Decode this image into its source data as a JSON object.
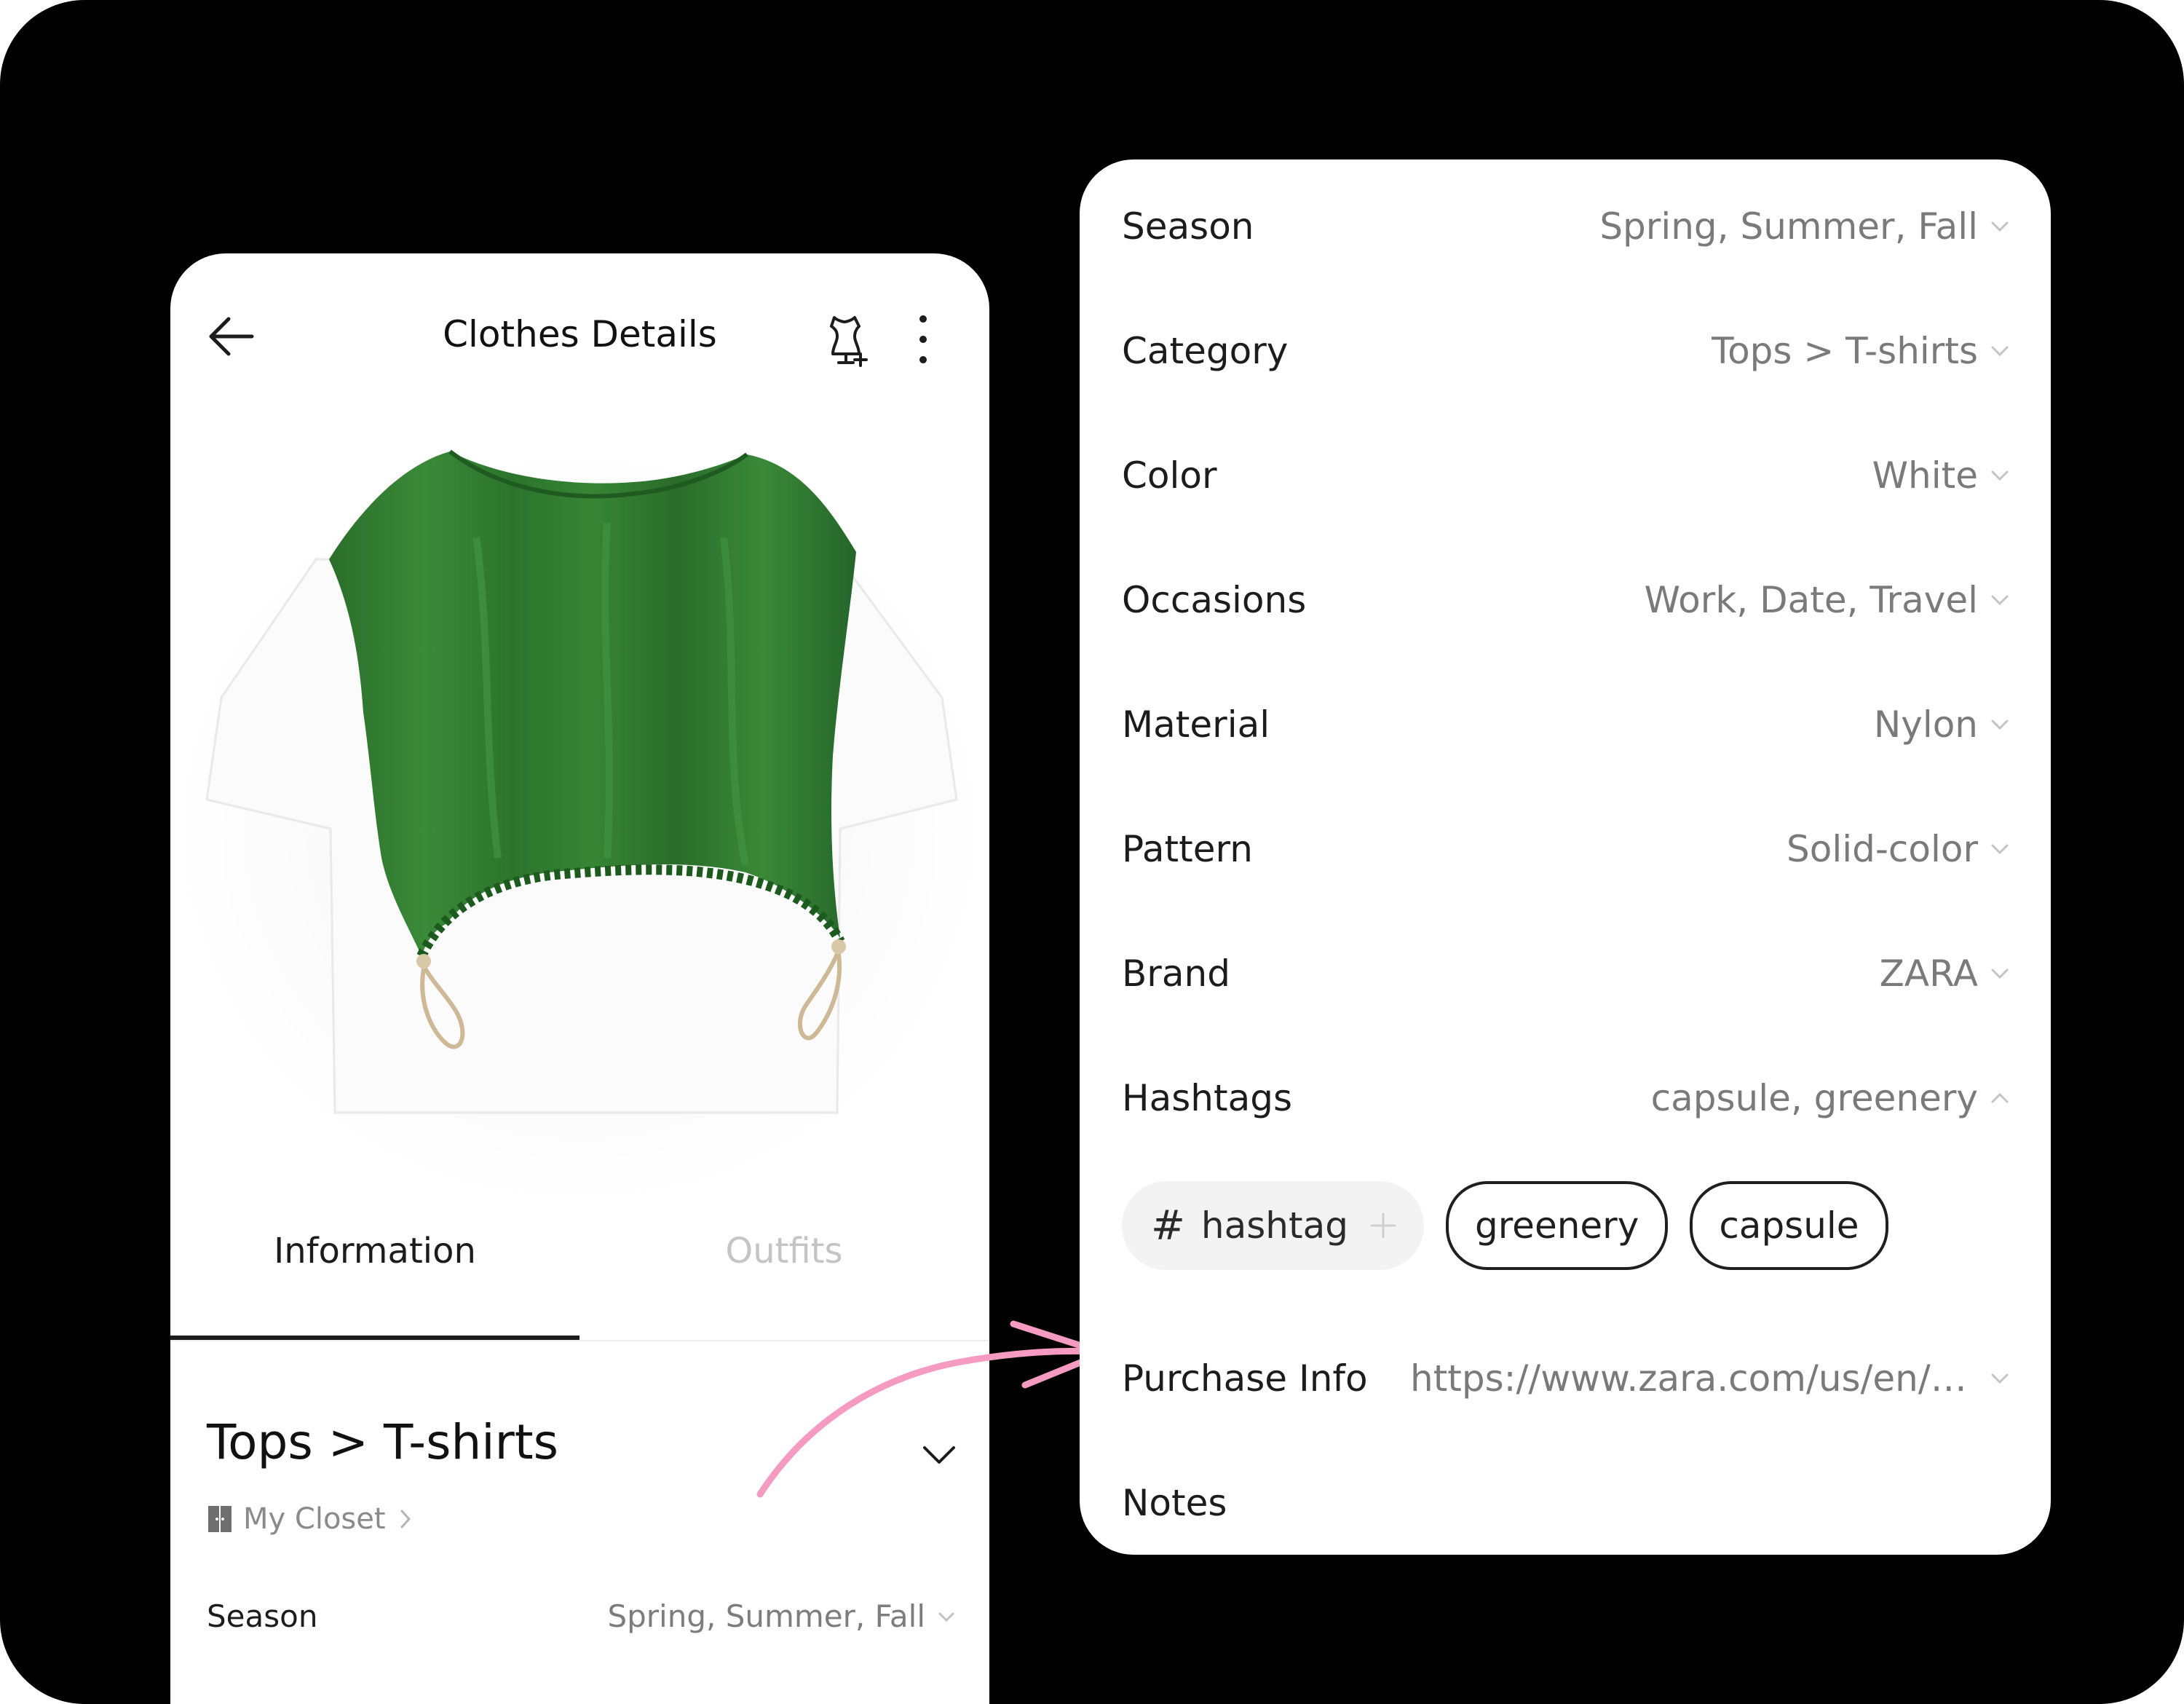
{
  "phone": {
    "header": {
      "title": "Clothes Details",
      "back_icon": "arrow-left-icon",
      "wardrobe_icon": "dress-form-add-icon",
      "more_icon": "more-vertical-icon"
    },
    "tabs": [
      {
        "label": "Information",
        "active": true
      },
      {
        "label": "Outfits",
        "active": false
      }
    ],
    "category_title": "Tops > T-shirts",
    "closet": {
      "label": "My Closet",
      "icon": "closet-icon"
    },
    "season": {
      "label": "Season",
      "value": "Spring, Summer, Fall"
    }
  },
  "details": {
    "rows": [
      {
        "label": "Season",
        "value": "Spring, Summer, Fall",
        "expanded": false
      },
      {
        "label": "Category",
        "value": "Tops > T-shirts",
        "expanded": false
      },
      {
        "label": "Color",
        "value": "White",
        "expanded": false
      },
      {
        "label": "Occasions",
        "value": "Work, Date, Travel",
        "expanded": false
      },
      {
        "label": "Material",
        "value": "Nylon",
        "expanded": false
      },
      {
        "label": "Pattern",
        "value": "Solid-color",
        "expanded": false
      },
      {
        "label": "Brand",
        "value": "ZARA",
        "expanded": false
      },
      {
        "label": "Hashtags",
        "value": "capsule, greenery",
        "expanded": true
      }
    ],
    "hashtag_input": {
      "symbol": "#",
      "placeholder": "hashtag"
    },
    "hashtag_chips": [
      "greenery",
      "capsule"
    ],
    "purchase": {
      "label": "Purchase Info",
      "value": "https://www.zara.com/us/en/c⋯"
    },
    "notes": {
      "label": "Notes"
    }
  },
  "colors": {
    "background": "#000000",
    "card": "#ffffff",
    "connector_arrow": "#f59ac0",
    "shirt_green": "#2f7a30",
    "muted_text": "#7a7a7a"
  }
}
